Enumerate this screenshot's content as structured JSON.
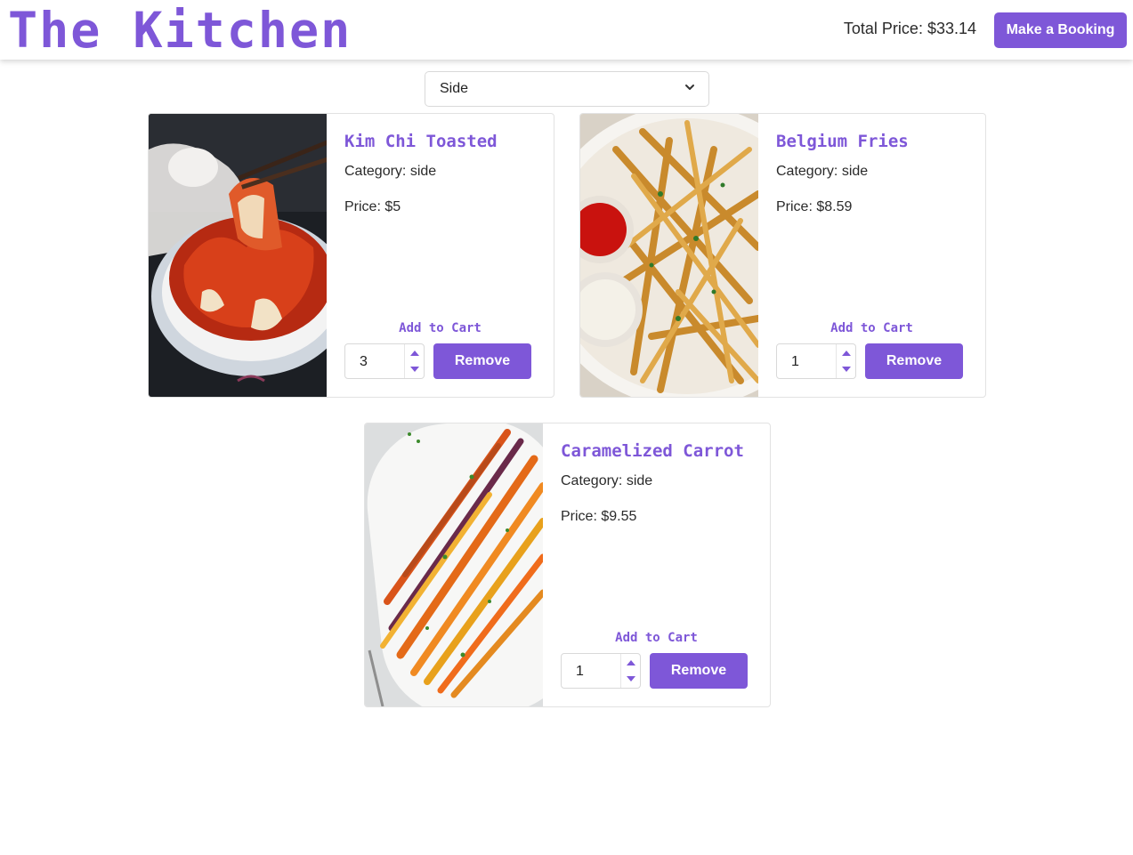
{
  "header": {
    "brand": "The Kitchen",
    "total_label": "Total Price: $33.14",
    "booking_label": "Make a Booking"
  },
  "filter": {
    "selected": "Side"
  },
  "colors": {
    "accent": "#7e57d8"
  },
  "items": [
    {
      "name": "Kim Chi Toasted",
      "category": "Category: side",
      "price": "Price: $5",
      "add_label": "Add to Cart",
      "quantity": "3",
      "remove_label": "Remove",
      "image": "kimchi-bowl-image"
    },
    {
      "name": "Belgium Fries",
      "category": "Category: side",
      "price": "Price: $8.59",
      "add_label": "Add to Cart",
      "quantity": "1",
      "remove_label": "Remove",
      "image": "fries-plate-image"
    },
    {
      "name": "Caramelized Carrot",
      "category": "Category: side",
      "price": "Price: $9.55",
      "add_label": "Add to Cart",
      "quantity": "1",
      "remove_label": "Remove",
      "image": "carrots-platter-image"
    }
  ]
}
